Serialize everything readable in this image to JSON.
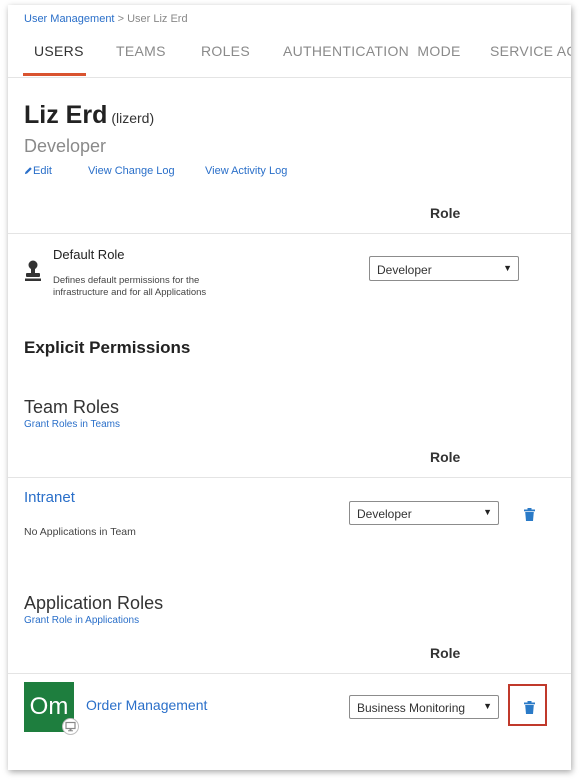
{
  "breadcrumb": {
    "parent": "User Management",
    "separator": ">",
    "current": "User Liz Erd"
  },
  "tabs": [
    {
      "label": "USERS",
      "active": true
    },
    {
      "label": "TEAMS"
    },
    {
      "label": "ROLES"
    },
    {
      "label": "AUTHENTICATION  MODE"
    },
    {
      "label": "SERVICE ACC"
    }
  ],
  "user": {
    "name": "Liz Erd",
    "username": "(lizerd)",
    "title": "Developer"
  },
  "actions": {
    "edit": "Edit",
    "change_log": "View Change Log",
    "activity_log": "View Activity Log"
  },
  "default_role": {
    "column_header": "Role",
    "title": "Default Role",
    "description": "Defines default permissions for the infrastructure and for all Applications",
    "selected": "Developer",
    "icon": "user-stamp-icon"
  },
  "explicit_permissions": {
    "heading": "Explicit Permissions"
  },
  "team_roles": {
    "heading": "Team Roles",
    "grant_link": "Grant Roles in Teams",
    "column_header": "Role",
    "team": {
      "name": "Intranet",
      "note": "No Applications in Team",
      "selected": "Developer"
    }
  },
  "application_roles": {
    "heading": "Application Roles",
    "grant_link": "Grant Role in Applications",
    "column_header": "Role",
    "app": {
      "initials": "Om",
      "name": "Order Management",
      "selected": "Business Monitoring"
    }
  },
  "colors": {
    "link": "#2a6fc9",
    "active_tab": "#d9532f",
    "app_tile": "#1e7e3e",
    "highlight": "#c0392b",
    "trash": "#2a7ac7"
  }
}
